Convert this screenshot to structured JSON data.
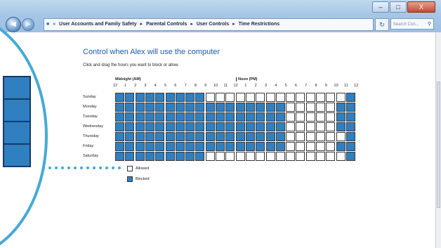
{
  "window": {
    "caption_minimize": "–",
    "caption_maximize": "□",
    "caption_close": "X"
  },
  "nav": {
    "back_icon": "back-arrow-icon",
    "forward_icon": "forward-arrow-icon",
    "breadcrumbs": [
      "User Accounts and Family Safety",
      "Parental Controls",
      "User Controls",
      "Time Restrictions"
    ],
    "separator": "▸",
    "refresh_label": "↻",
    "search_placeholder": "Search Con...",
    "search_icon": "magnifier-icon"
  },
  "page": {
    "title": "Control when Alex will use the computer",
    "instructions": "Click and drag the hours you want to block or allow."
  },
  "schedule": {
    "am_label": "Midnight (AM)",
    "pm_label": "Noon (PM)",
    "hours": [
      "12",
      "1",
      "2",
      "3",
      "4",
      "5",
      "6",
      "7",
      "8",
      "9",
      "10",
      "11",
      "12",
      "1",
      "2",
      "3",
      "4",
      "5",
      "6",
      "7",
      "8",
      "9",
      "10",
      "11",
      "12"
    ],
    "days": [
      "Sunday",
      "Monday",
      "Tuesday",
      "Wednesday",
      "Thursday",
      "Friday",
      "Saturday"
    ],
    "grid": [
      "BBBBBBBBBAAAAAAAAAAAAAAB",
      "BBBBBBBBBBBBBBBBBAAAAABBBB",
      "BBBBBBBBBBBBBBBBBAAAAABBBB",
      "BBBBBBBBBBBBBBBBBAAAAABBBB",
      "BBBBBBBBBBBBBBBBBAAAAAABBB",
      "BBBBBBBBBBBBBBBBBAAAAABBBB",
      "BBBBBBBBBAAAAAAAAAAAAAAB"
    ]
  },
  "legend": {
    "allowed": "Allowed",
    "blocked": "Blocked",
    "allowed_color": "#ffffff",
    "blocked_color": "#2f7fc1"
  },
  "colors": {
    "accent": "#45a9d6",
    "blocked": "#2f7fc1",
    "title": "#1e5aa8"
  }
}
